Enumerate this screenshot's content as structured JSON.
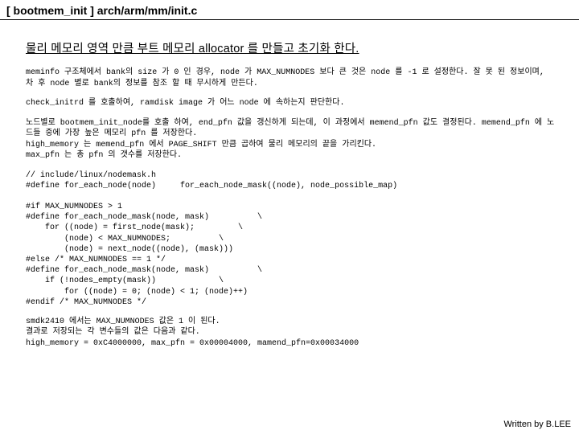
{
  "header": {
    "title": "[ bootmem_init ] arch/arm/mm/init.c"
  },
  "body": {
    "title": "물리 메모리 영역 만큼 부트 메모리 allocator 를 만들고 초기화 한다.",
    "para1": "meminfo 구조체에서 bank의 size 가 0 인 경우, node 가 MAX_NUMNODES 보다 큰 것은 node 를 -1 로 설정한다. 잘 못 된 정보이며, 차 후 node 별로 bank의 정보를 참조 할 때 무시하게 만든다.",
    "para2": "check_initrd 를 호출하여, ramdisk image 가 어느 node 에 속하는지 판단한다.",
    "para3": "노드별로 bootmem_init_node를 호출 하여, end_pfn 값을 갱신하게 되는데, 이 과정에서 memend_pfn 값도 결정된다. memend_pfn 에 노드들 중에 가장 높은 메모리 pfn 를 저장한다.\nhigh_memory 는 memend_pfn 에서 PAGE_SHIFT 만큼 곱하여 물리 메모리의 끝을 가리킨다.\nmax_pfn 는 총 pfn 의 갯수를 저장한다.",
    "code1": "// include/linux/nodemask.h\n#define for_each_node(node)     for_each_node_mask((node), node_possible_map)\n\n#if MAX_NUMNODES > 1\n#define for_each_node_mask(node, mask)          \\\n    for ((node) = first_node(mask);         \\\n        (node) < MAX_NUMNODES;          \\\n        (node) = next_node((node), (mask)))\n#else /* MAX_NUMNODES == 1 */\n#define for_each_node_mask(node, mask)          \\\n    if (!nodes_empty(mask))             \\\n        for ((node) = 0; (node) < 1; (node)++)\n#endif /* MAX_NUMNODES */",
    "para4": "smdk2410 에서는 MAX_NUMNODES 값은 1 이 된다.\n결과로 저장되는 각 변수들의 값은 다음과 같다.\nhigh_memory = 0xC4000000, max_pfn = 0x00004000, mamend_pfn=0x00034000"
  },
  "footer": {
    "credit": "Written by B.LEE"
  }
}
